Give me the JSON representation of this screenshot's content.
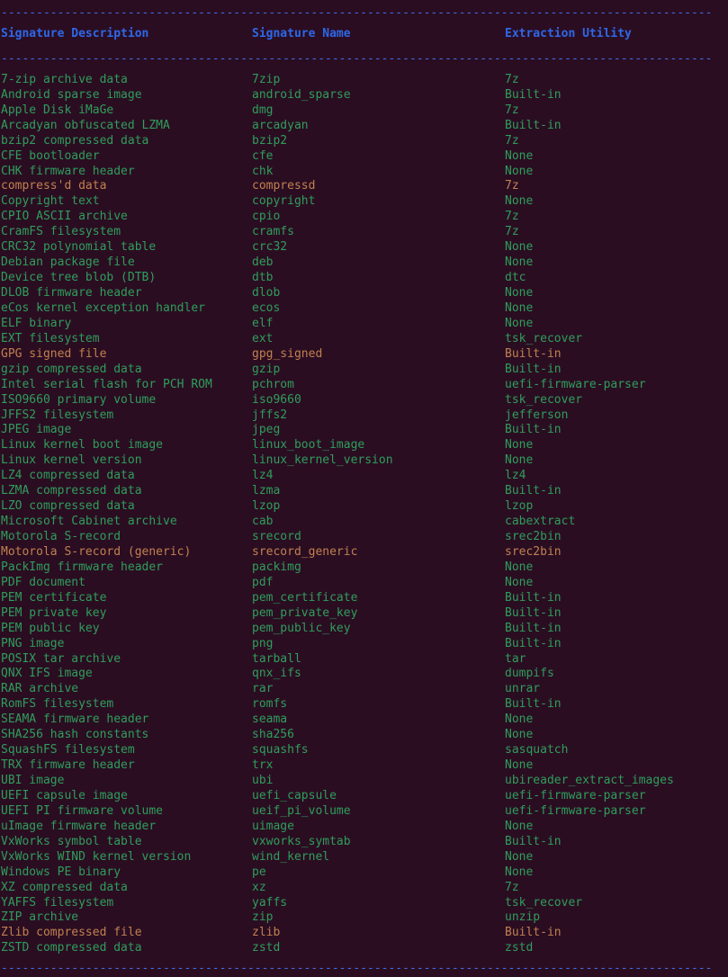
{
  "terminal": {
    "background_color": "#2b0d22",
    "header_color": "#2d68e8",
    "rule_color": "#3b6ee0",
    "row_color_default": "#2e9e5b",
    "row_color_highlight": "#c0814e",
    "separator_char": "-",
    "separator_text": "-------------------------------------------------------------------------------------------------"
  },
  "table": {
    "headers": {
      "description": "Signature Description",
      "name": "Signature Name",
      "utility": "Extraction Utility"
    },
    "rows": [
      {
        "description": "7-zip archive data",
        "name": "7zip",
        "utility": "7z",
        "highlight": false
      },
      {
        "description": "Android sparse image",
        "name": "android_sparse",
        "utility": "Built-in",
        "highlight": false
      },
      {
        "description": "Apple Disk iMaGe",
        "name": "dmg",
        "utility": "7z",
        "highlight": false
      },
      {
        "description": "Arcadyan obfuscated LZMA",
        "name": "arcadyan",
        "utility": "Built-in",
        "highlight": false
      },
      {
        "description": "bzip2 compressed data",
        "name": "bzip2",
        "utility": "7z",
        "highlight": false
      },
      {
        "description": "CFE bootloader",
        "name": "cfe",
        "utility": "None",
        "highlight": false
      },
      {
        "description": "CHK firmware header",
        "name": "chk",
        "utility": "None",
        "highlight": false
      },
      {
        "description": "compress'd data",
        "name": "compressd",
        "utility": "7z",
        "highlight": true
      },
      {
        "description": "Copyright text",
        "name": "copyright",
        "utility": "None",
        "highlight": false
      },
      {
        "description": "CPIO ASCII archive",
        "name": "cpio",
        "utility": "7z",
        "highlight": false
      },
      {
        "description": "CramFS filesystem",
        "name": "cramfs",
        "utility": "7z",
        "highlight": false
      },
      {
        "description": "CRC32 polynomial table",
        "name": "crc32",
        "utility": "None",
        "highlight": false
      },
      {
        "description": "Debian package file",
        "name": "deb",
        "utility": "None",
        "highlight": false
      },
      {
        "description": "Device tree blob (DTB)",
        "name": "dtb",
        "utility": "dtc",
        "highlight": false
      },
      {
        "description": "DLOB firmware header",
        "name": "dlob",
        "utility": "None",
        "highlight": false
      },
      {
        "description": "eCos kernel exception handler",
        "name": "ecos",
        "utility": "None",
        "highlight": false
      },
      {
        "description": "ELF binary",
        "name": "elf",
        "utility": "None",
        "highlight": false
      },
      {
        "description": "EXT filesystem",
        "name": "ext",
        "utility": "tsk_recover",
        "highlight": false
      },
      {
        "description": "GPG signed file",
        "name": "gpg_signed",
        "utility": "Built-in",
        "highlight": true
      },
      {
        "description": "gzip compressed data",
        "name": "gzip",
        "utility": "Built-in",
        "highlight": false
      },
      {
        "description": "Intel serial flash for PCH ROM",
        "name": "pchrom",
        "utility": "uefi-firmware-parser",
        "highlight": false
      },
      {
        "description": "ISO9660 primary volume",
        "name": "iso9660",
        "utility": "tsk_recover",
        "highlight": false
      },
      {
        "description": "JFFS2 filesystem",
        "name": "jffs2",
        "utility": "jefferson",
        "highlight": false
      },
      {
        "description": "JPEG image",
        "name": "jpeg",
        "utility": "Built-in",
        "highlight": false
      },
      {
        "description": "Linux kernel boot image",
        "name": "linux_boot_image",
        "utility": "None",
        "highlight": false
      },
      {
        "description": "Linux kernel version",
        "name": "linux_kernel_version",
        "utility": "None",
        "highlight": false
      },
      {
        "description": "LZ4 compressed data",
        "name": "lz4",
        "utility": "lz4",
        "highlight": false
      },
      {
        "description": "LZMA compressed data",
        "name": "lzma",
        "utility": "Built-in",
        "highlight": false
      },
      {
        "description": "LZO compressed data",
        "name": "lzop",
        "utility": "lzop",
        "highlight": false
      },
      {
        "description": "Microsoft Cabinet archive",
        "name": "cab",
        "utility": "cabextract",
        "highlight": false
      },
      {
        "description": "Motorola S-record",
        "name": "srecord",
        "utility": "srec2bin",
        "highlight": false
      },
      {
        "description": "Motorola S-record (generic)",
        "name": "srecord_generic",
        "utility": "srec2bin",
        "highlight": true
      },
      {
        "description": "PackImg firmware header",
        "name": "packimg",
        "utility": "None",
        "highlight": false
      },
      {
        "description": "PDF document",
        "name": "pdf",
        "utility": "None",
        "highlight": false
      },
      {
        "description": "PEM certificate",
        "name": "pem_certificate",
        "utility": "Built-in",
        "highlight": false
      },
      {
        "description": "PEM private key",
        "name": "pem_private_key",
        "utility": "Built-in",
        "highlight": false
      },
      {
        "description": "PEM public key",
        "name": "pem_public_key",
        "utility": "Built-in",
        "highlight": false
      },
      {
        "description": "PNG image",
        "name": "png",
        "utility": "Built-in",
        "highlight": false
      },
      {
        "description": "POSIX tar archive",
        "name": "tarball",
        "utility": "tar",
        "highlight": false
      },
      {
        "description": "QNX IFS image",
        "name": "qnx_ifs",
        "utility": "dumpifs",
        "highlight": false
      },
      {
        "description": "RAR archive",
        "name": "rar",
        "utility": "unrar",
        "highlight": false
      },
      {
        "description": "RomFS filesystem",
        "name": "romfs",
        "utility": "Built-in",
        "highlight": false
      },
      {
        "description": "SEAMA firmware header",
        "name": "seama",
        "utility": "None",
        "highlight": false
      },
      {
        "description": "SHA256 hash constants",
        "name": "sha256",
        "utility": "None",
        "highlight": false
      },
      {
        "description": "SquashFS filesystem",
        "name": "squashfs",
        "utility": "sasquatch",
        "highlight": false
      },
      {
        "description": "TRX firmware header",
        "name": "trx",
        "utility": "None",
        "highlight": false
      },
      {
        "description": "UBI image",
        "name": "ubi",
        "utility": "ubireader_extract_images",
        "highlight": false
      },
      {
        "description": "UEFI capsule image",
        "name": "uefi_capsule",
        "utility": "uefi-firmware-parser",
        "highlight": false
      },
      {
        "description": "UEFI PI firmware volume",
        "name": "ueif_pi_volume",
        "utility": "uefi-firmware-parser",
        "highlight": false
      },
      {
        "description": "uImage firmware header",
        "name": "uimage",
        "utility": "None",
        "highlight": false
      },
      {
        "description": "VxWorks symbol table",
        "name": "vxworks_symtab",
        "utility": "Built-in",
        "highlight": false
      },
      {
        "description": "VxWorks WIND kernel version",
        "name": "wind_kernel",
        "utility": "None",
        "highlight": false
      },
      {
        "description": "Windows PE binary",
        "name": "pe",
        "utility": "None",
        "highlight": false
      },
      {
        "description": "XZ compressed data",
        "name": "xz",
        "utility": "7z",
        "highlight": false
      },
      {
        "description": "YAFFS filesystem",
        "name": "yaffs",
        "utility": "tsk_recover",
        "highlight": false
      },
      {
        "description": "ZIP archive",
        "name": "zip",
        "utility": "unzip",
        "highlight": false
      },
      {
        "description": "Zlib compressed file",
        "name": "zlib",
        "utility": "Built-in",
        "highlight": true
      },
      {
        "description": "ZSTD compressed data",
        "name": "zstd",
        "utility": "zstd",
        "highlight": false
      }
    ]
  }
}
